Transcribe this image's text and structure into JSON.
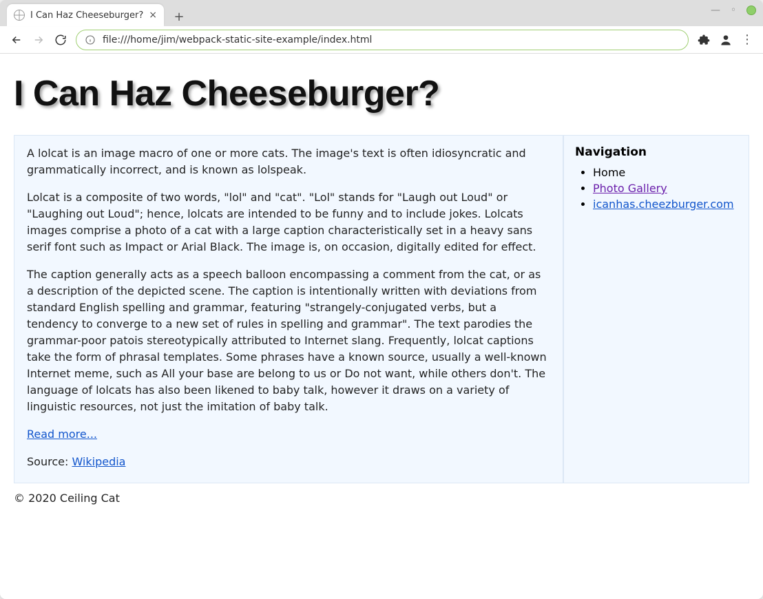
{
  "browser": {
    "tab_title": "I Can Haz Cheeseburger?",
    "url": "file:///home/jim/webpack-static-site-example/index.html"
  },
  "page": {
    "heading": "I Can Haz Cheeseburger?",
    "paragraphs": [
      "A lolcat is an image macro of one or more cats. The image's text is often idiosyncratic and grammatically incorrect, and is known as lolspeak.",
      "Lolcat is a composite of two words, \"lol\" and \"cat\". \"Lol\" stands for \"Laugh out Loud\" or \"Laughing out Loud\"; hence, lolcats are intended to be funny and to include jokes. Lolcats images comprise a photo of a cat with a large caption characteristically set in a heavy sans serif font such as Impact or Arial Black. The image is, on occasion, digitally edited for effect.",
      "The caption generally acts as a speech balloon encompassing a comment from the cat, or as a description of the depicted scene. The caption is intentionally written with deviations from standard English spelling and grammar, featuring \"strangely-conjugated verbs, but a tendency to converge to a new set of rules in spelling and grammar\". The text parodies the grammar-poor patois stereotypically attributed to Internet slang. Frequently, lolcat captions take the form of phrasal templates. Some phrases have a known source, usually a well-known Internet meme, such as All your base are belong to us or Do not want, while others don't. The language of lolcats has also been likened to baby talk, however it draws on a variety of linguistic resources, not just the imitation of baby talk."
    ],
    "read_more": "Read more...",
    "source_prefix": "Source: ",
    "source_link": "Wikipedia",
    "footer": "© 2020 Ceiling Cat"
  },
  "sidebar": {
    "heading": "Navigation",
    "items": [
      {
        "label": "Home",
        "link": false
      },
      {
        "label": "Photo Gallery",
        "link": true,
        "visited": true
      },
      {
        "label": "icanhas.cheezburger.com",
        "link": true,
        "visited": false
      }
    ]
  }
}
